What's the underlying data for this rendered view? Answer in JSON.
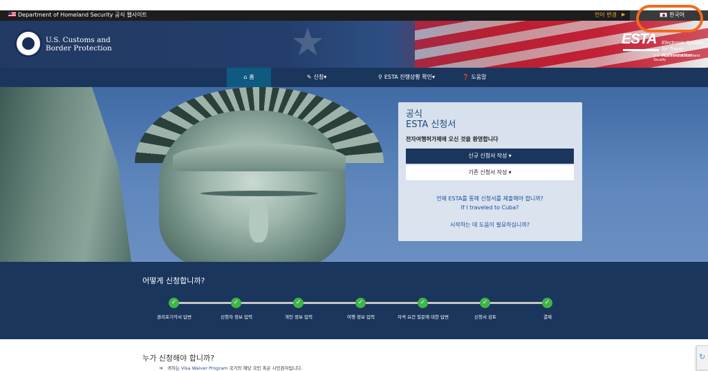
{
  "gov_banner": {
    "text": "Department of Homeland Security 공식 웹사이트",
    "language_change": "언어 변경",
    "current_language": "한국어"
  },
  "header": {
    "agency_line1": "U.S. Customs and",
    "agency_line2": "Border Protection",
    "esta_logo": "ESTA",
    "esta_tagline": "Electronic System for Travel Authorization",
    "esta_dept": "U.S. Department of Homeland Security"
  },
  "nav": {
    "home": "홈",
    "apply": "신청",
    "status": "ESTA 진행상황 확인",
    "help": "도움말"
  },
  "apply_card": {
    "title_line1": "공식",
    "title_line2": "ESTA 신청서",
    "welcome": "전자여행허가제에 오신 것을 환영합니다",
    "new_application": "신규 신청서 작성",
    "existing_application": "기존 신청서 작성",
    "when_link": "언제 ESTA를 통해 신청서를 제출해야 합니까?",
    "cuba_link": "If I traveled to Cuba?",
    "help_link": "시작하는 데 도움이 필요하십니까?"
  },
  "steps": {
    "title": "어떻게 신청합니까?",
    "items": [
      {
        "label": "권리포기각서 답변"
      },
      {
        "label": "신청자 정보 입력"
      },
      {
        "label": "개인 정보 입력"
      },
      {
        "label": "여행 정보 입력"
      },
      {
        "label": "자격 요건 질문에 대한 답변"
      },
      {
        "label": "신청서 검토"
      },
      {
        "label": "결제"
      }
    ]
  },
  "who": {
    "title": "누가 신청해야 합니까?",
    "bullet_prefix": "귀하는",
    "bullet_link": "Visa Waiver Program",
    "bullet_suffix": "국가의 해당 국민 혹은 시민권자입니다."
  },
  "colors": {
    "nav_bg": "#1b365d",
    "nav_active": "#0f5a80",
    "step_check": "#3fb54a",
    "annotation": "#f26a1b",
    "link": "#1b4a9a"
  }
}
